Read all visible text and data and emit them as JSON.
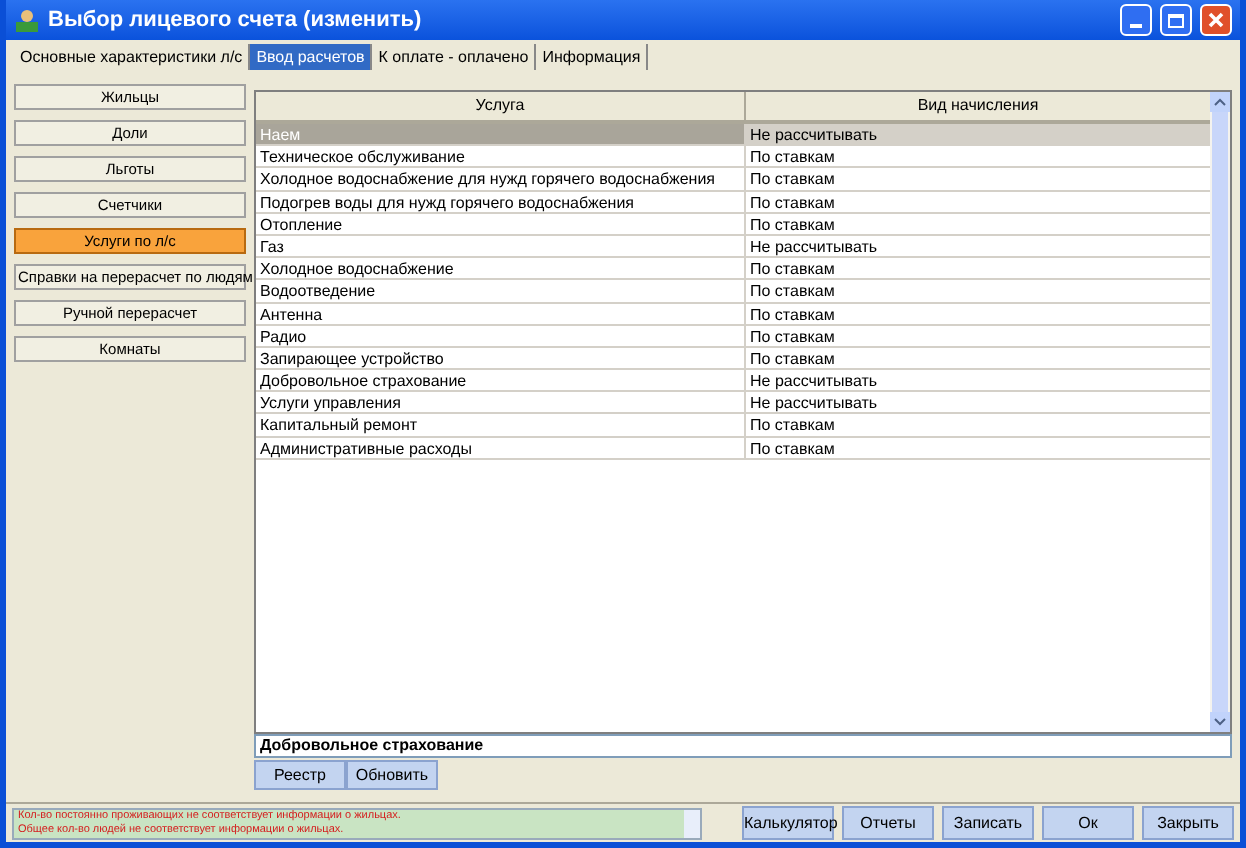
{
  "window": {
    "title": "Выбор лицевого счета (изменить)"
  },
  "tabs": [
    {
      "label": "Основные характеристики л/с",
      "selected": false
    },
    {
      "label": "Ввод расчетов",
      "selected": true
    },
    {
      "label": "К оплате - оплачено",
      "selected": false
    },
    {
      "label": "Информация",
      "selected": false
    }
  ],
  "sidebar": {
    "items": [
      {
        "label": "Жильцы",
        "selected": false
      },
      {
        "label": "Доли",
        "selected": false
      },
      {
        "label": "Льготы",
        "selected": false
      },
      {
        "label": "Счетчики",
        "selected": false
      },
      {
        "label": "Услуги по л/с",
        "selected": true
      },
      {
        "label": "Справки на перерасчет по людям",
        "selected": false
      },
      {
        "label": "Ручной перерасчет",
        "selected": false
      },
      {
        "label": "Комнаты",
        "selected": false
      }
    ]
  },
  "table": {
    "columns": [
      "Услуга",
      "Вид начисления"
    ],
    "rows": [
      {
        "cells": [
          "Наем",
          "Не рассчитывать"
        ],
        "selected": true
      },
      {
        "cells": [
          "Техническое обслуживание",
          "По ставкам"
        ],
        "selected": false
      },
      {
        "cells": [
          "Холодное водоснабжение для нужд горячего водоснабжения",
          "По ставкам"
        ],
        "selected": false
      },
      {
        "cells": [
          "Подогрев воды для нужд горячего водоснабжения",
          "По ставкам"
        ],
        "selected": false
      },
      {
        "cells": [
          "Отопление",
          "По ставкам"
        ],
        "selected": false
      },
      {
        "cells": [
          "Газ",
          "Не рассчитывать"
        ],
        "selected": false
      },
      {
        "cells": [
          "Холодное водоснабжение",
          "По ставкам"
        ],
        "selected": false
      },
      {
        "cells": [
          "Водоотведение",
          "По ставкам"
        ],
        "selected": false
      },
      {
        "cells": [
          "Антенна",
          "По ставкам"
        ],
        "selected": false
      },
      {
        "cells": [
          "Радио",
          "По ставкам"
        ],
        "selected": false
      },
      {
        "cells": [
          "Запирающее устройство",
          "По ставкам"
        ],
        "selected": false
      },
      {
        "cells": [
          "Добровольное страхование",
          "Не рассчитывать"
        ],
        "selected": false
      },
      {
        "cells": [
          "Услуги управления",
          "Не рассчитывать"
        ],
        "selected": false
      },
      {
        "cells": [
          "Капитальный ремонт",
          "По ставкам"
        ],
        "selected": false
      },
      {
        "cells": [
          "Административные расходы",
          "По ставкам"
        ],
        "selected": false
      }
    ]
  },
  "detail": {
    "value": "Добровольное страхование"
  },
  "panel_buttons": [
    "Реестр",
    "Обновить"
  ],
  "status_bar": {
    "messages": [
      "Кол-во постоянно проживающих не соответствует информации о жильцах.",
      "Общее кол-во людей не соответствует информации о жильцах."
    ]
  },
  "buttons": [
    "Калькулятор",
    "Отчеты",
    "Записать",
    "Ок",
    "Закрыть"
  ]
}
